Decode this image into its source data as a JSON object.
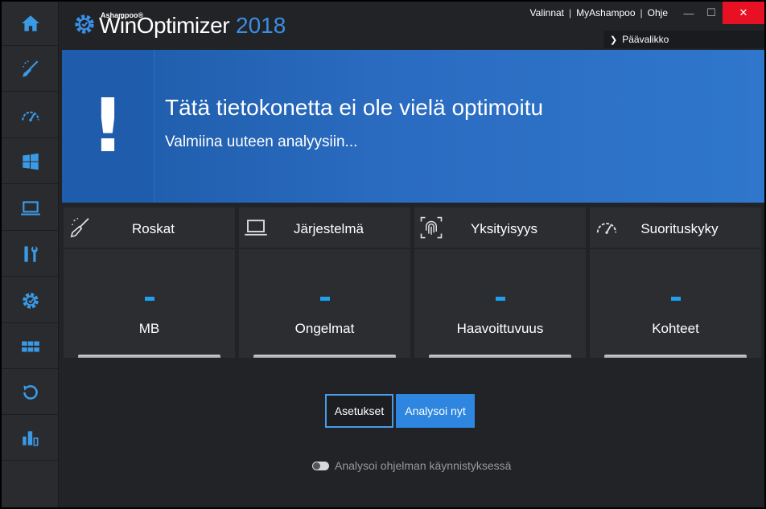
{
  "app": {
    "brand": "Ashampoo®",
    "name": "WinOptimizer",
    "year": "2018"
  },
  "top_menu": {
    "options": "Valinnat",
    "account": "MyAshampoo",
    "help": "Ohje",
    "main_menu": "Päävalikko"
  },
  "sidebar": {
    "items": [
      {
        "icon": "home-icon"
      },
      {
        "icon": "broom-icon"
      },
      {
        "icon": "speedometer-icon"
      },
      {
        "icon": "windows-icon"
      },
      {
        "icon": "laptop-icon"
      },
      {
        "icon": "tools-icon"
      },
      {
        "icon": "gear-icon"
      },
      {
        "icon": "grid-icon"
      },
      {
        "icon": "restore-icon"
      },
      {
        "icon": "bar-chart-icon"
      }
    ]
  },
  "banner": {
    "symbol": "!",
    "title": "Tätä tietokonetta ei ole vielä optimoitu",
    "subtitle": "Valmiina uuteen analyysiin..."
  },
  "cards": [
    {
      "title": "Roskat",
      "icon": "broom-icon",
      "value": "-",
      "unit": "MB"
    },
    {
      "title": "Järjestelmä",
      "icon": "laptop-icon",
      "value": "-",
      "unit": "Ongelmat"
    },
    {
      "title": "Yksityisyys",
      "icon": "fingerprint-icon",
      "value": "-",
      "unit": "Haavoittuvuus"
    },
    {
      "title": "Suorituskyky",
      "icon": "speedometer-icon",
      "value": "-",
      "unit": "Kohteet"
    }
  ],
  "actions": {
    "settings": "Asetukset",
    "analyze": "Analysoi nyt",
    "startup_toggle_label": "Analysoi ohjelman käynnistyksessä",
    "startup_toggle_on": false
  },
  "colors": {
    "accent": "#2e86e0",
    "banner": "#2a6bc0",
    "close": "#e81123",
    "value": "#1ea0f0"
  }
}
